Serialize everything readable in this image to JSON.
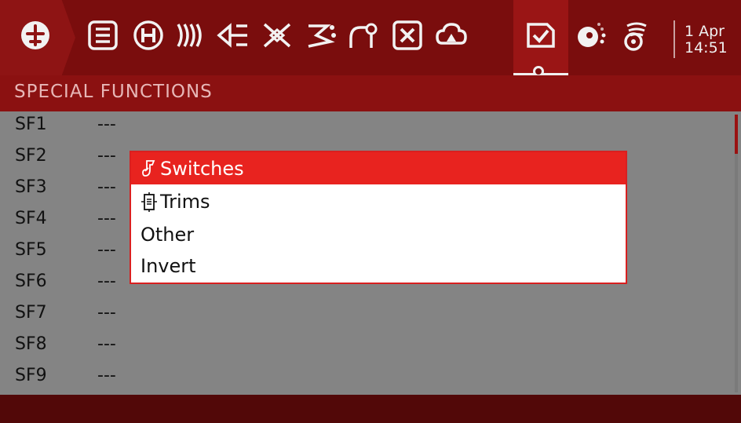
{
  "topbar": {
    "icons": [
      "model-select-icon",
      "setup-list-icon",
      "heli-icon",
      "flight-modes-icon",
      "inputs-icon",
      "mixer-icon",
      "outputs-icon",
      "curves-icon",
      "global-vars-icon",
      "logical-switches-icon",
      "special-functions-icon",
      "telemetry-icon",
      "radio-signal-icon"
    ],
    "date": "1 Apr",
    "time": "14:51"
  },
  "page": {
    "title": "SPECIAL FUNCTIONS"
  },
  "rows": [
    {
      "label": "SF1",
      "value": "---"
    },
    {
      "label": "SF2",
      "value": "---"
    },
    {
      "label": "SF3",
      "value": "---"
    },
    {
      "label": "SF4",
      "value": "---"
    },
    {
      "label": "SF5",
      "value": "---"
    },
    {
      "label": "SF6",
      "value": "---"
    },
    {
      "label": "SF7",
      "value": "---"
    },
    {
      "label": "SF8",
      "value": "---"
    },
    {
      "label": "SF9",
      "value": "---"
    }
  ],
  "popup": {
    "items": [
      {
        "label": "Switches",
        "icon": "switch-icon",
        "selected": true
      },
      {
        "label": "Trims",
        "icon": "trim-icon",
        "selected": false
      },
      {
        "label": "Other",
        "icon": "",
        "selected": false
      },
      {
        "label": "Invert",
        "icon": "",
        "selected": false
      }
    ]
  },
  "colors": {
    "topbar": "#7a0d0d",
    "titlebar": "#8b1111",
    "list_background": "#848484",
    "selection": "#e8231f",
    "bottombar": "#520808"
  }
}
